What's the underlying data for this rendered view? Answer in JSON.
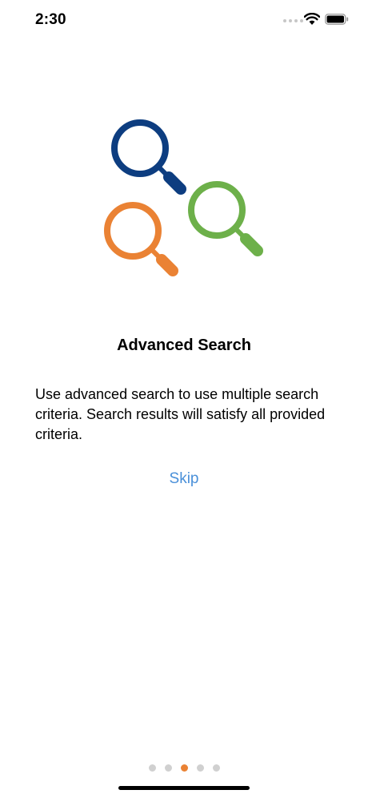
{
  "status_bar": {
    "time": "2:30",
    "signal_icon": "cellular-signal-icon",
    "wifi_icon": "wifi-icon",
    "battery_icon": "battery-icon"
  },
  "onboarding": {
    "illustration_icon": "magnifying-glasses-icon",
    "illustration_colors": [
      "#0d3d80",
      "#6db04a",
      "#ea8234"
    ],
    "title": "Advanced Search",
    "description": "Use advanced search to use multiple search criteria. Search results will satisfy all provided criteria.",
    "skip_label": "Skip",
    "accent_color": "#4a90d9"
  },
  "pager": {
    "page_count": 5,
    "current_page": 3
  }
}
